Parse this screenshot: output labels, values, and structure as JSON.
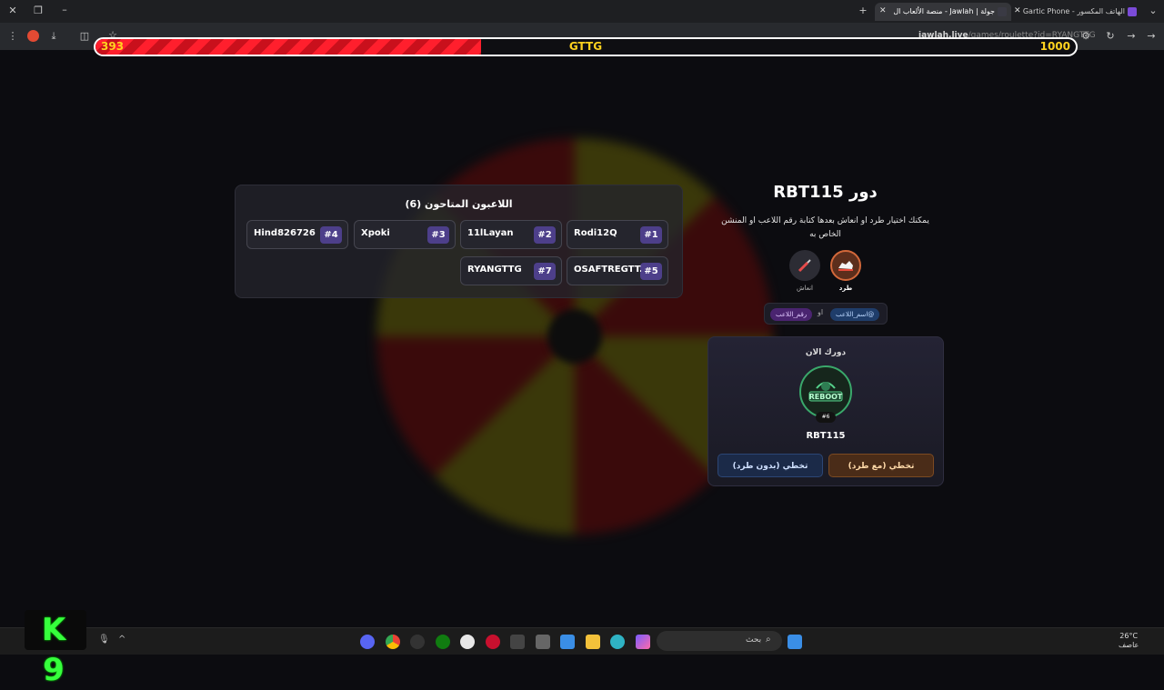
{
  "browser": {
    "tabs": [
      {
        "label": "الهاتف المكسور - Gartic Phone"
      },
      {
        "label": "جولة | Jawlah - منصة الألعاب ال"
      }
    ],
    "url_host": "jawlah.live",
    "url_path": "/games/roulette?id=RYANGTTG"
  },
  "progress": {
    "value": 393,
    "max": 1000,
    "fraction": 0.393,
    "left_label": "393",
    "center_label": "GTTG",
    "right_label": "1000"
  },
  "candidates": {
    "title": "اللاعبون المتاحون (6)",
    "players": [
      {
        "num": "#1",
        "name": "Rodi12Q"
      },
      {
        "num": "#2",
        "name": "11lLayan"
      },
      {
        "num": "#3",
        "name": "Xpoki"
      },
      {
        "num": "#4",
        "name": "Hind826726"
      },
      {
        "num": "#5",
        "name": "OSAFTREGTT..."
      },
      {
        "num": "#7",
        "name": "RYANGTTG"
      }
    ]
  },
  "turn": {
    "title": "دور RBT115",
    "description": "يمكنك اختيار طرد او انعاش بعدها كتابة رقم اللاعب او المنشن الخاص به",
    "actions": {
      "kick_label": "طرد",
      "revive_label": "انعاش"
    },
    "hint": {
      "mention_chip": "@اسم_اللاعب",
      "or_text": "او",
      "number_chip": "رقم_اللاعب"
    }
  },
  "now_card": {
    "label": "دورك الان",
    "avatar_badge": "#6",
    "avatar_text": "REBOOT",
    "player_name": "RBT115",
    "skip_with_kick": "تخطي (مع طرد)",
    "skip_without_kick": "تخطي (بدون طرد)"
  },
  "taskbar": {
    "search_placeholder": "بحث",
    "temperature": "26°C",
    "weather": "عاصف"
  },
  "overlay": {
    "watermark": "K 9"
  }
}
